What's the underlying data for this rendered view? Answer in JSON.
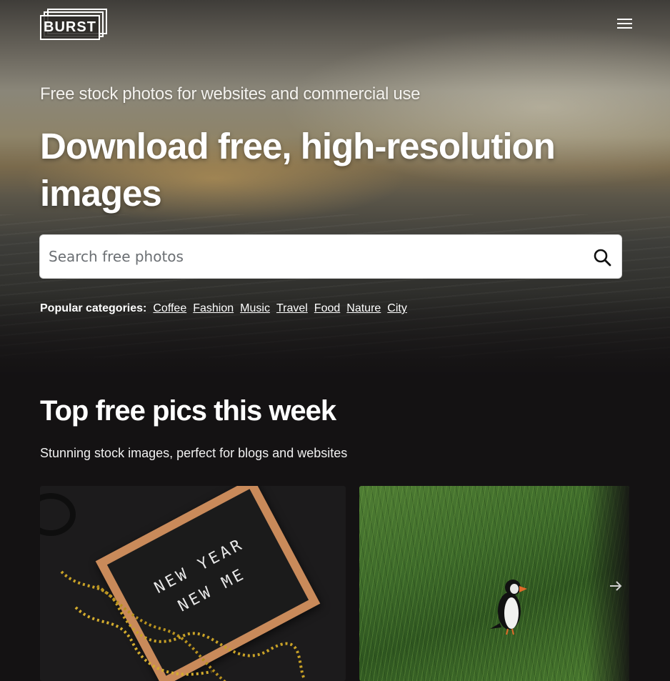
{
  "brand": {
    "logo_text": "BURST"
  },
  "header": {
    "menu_icon": "hamburger-menu-icon"
  },
  "hero": {
    "tagline": "Free stock photos for websites and commercial use",
    "headline": "Download free, high-resolution images",
    "search": {
      "placeholder": "Search free photos",
      "value": "",
      "icon": "search-icon"
    },
    "categories": {
      "label": "Popular categories:",
      "items": [
        "Coffee",
        "Fashion",
        "Music",
        "Travel",
        "Food",
        "Nature",
        "City"
      ]
    }
  },
  "section": {
    "title": "Top free pics this week",
    "subtitle": "Stunning stock images, perfect for blogs and websites",
    "cards": [
      {
        "board_line1": "NEW YEAR",
        "board_line2": "NEW ME"
      },
      {
        "subject": "puffin"
      }
    ],
    "carousel_next_icon": "arrow-right-icon"
  },
  "colors": {
    "page_bg": "#141213",
    "text": "#ffffff"
  }
}
